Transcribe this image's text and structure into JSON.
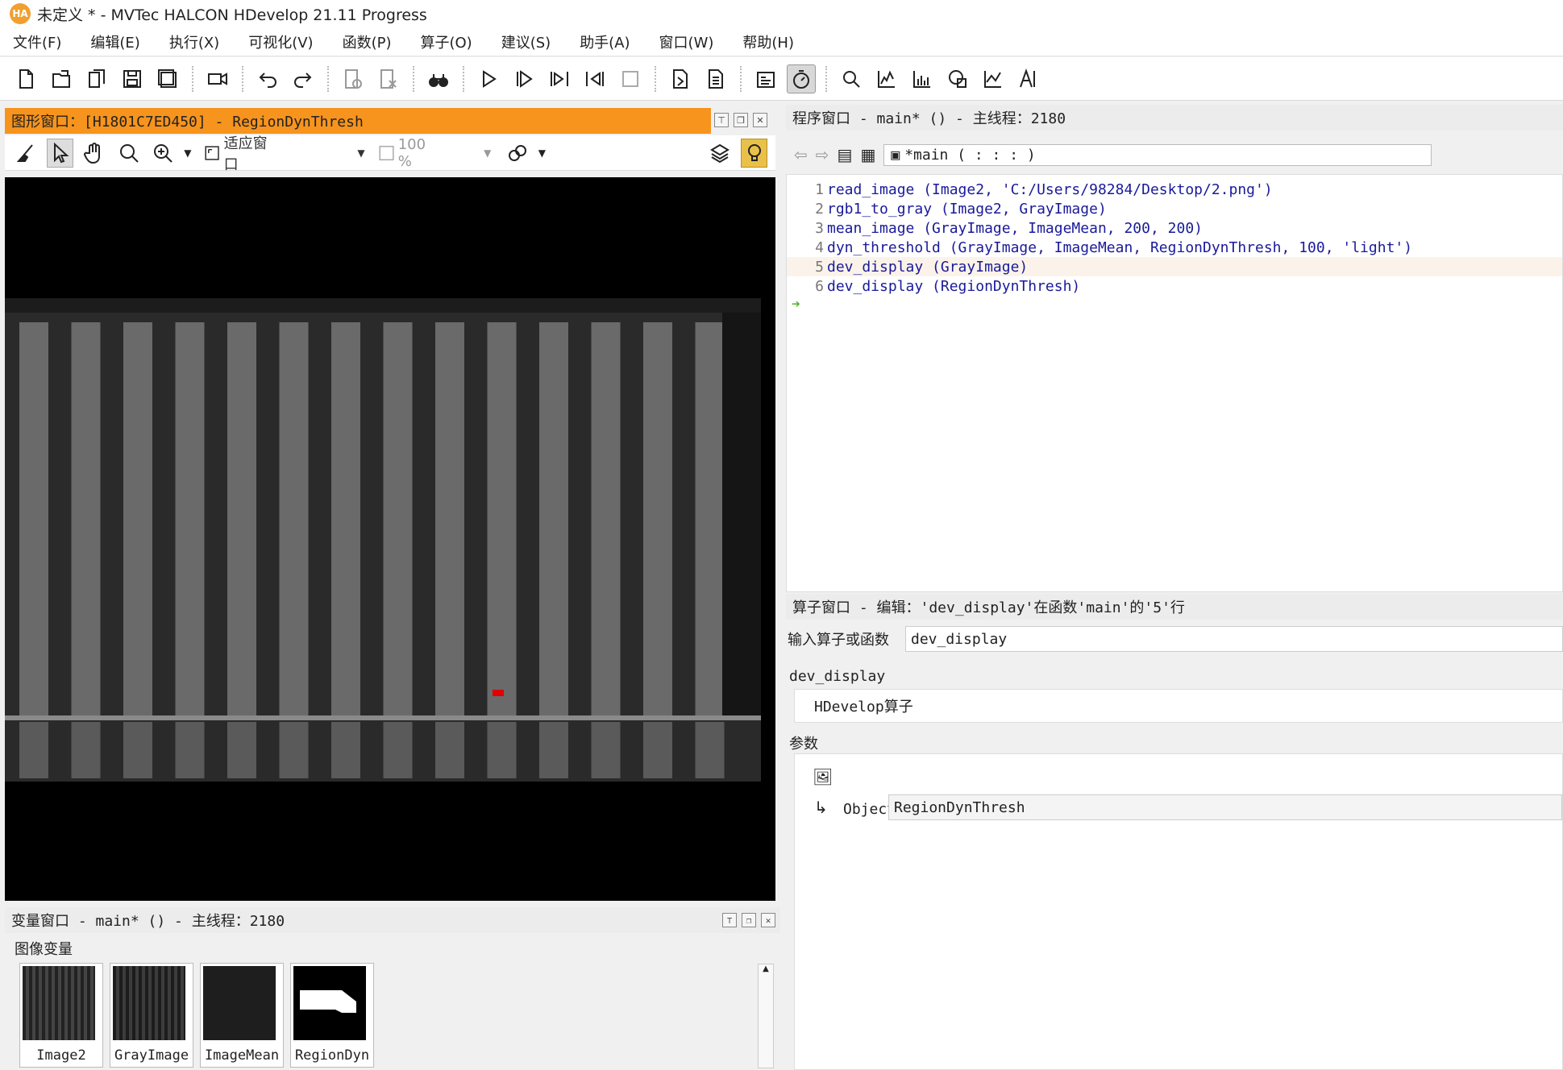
{
  "titlebar": {
    "logo": "HA",
    "title": "未定义 * - MVTec HALCON HDevelop 21.11 Progress"
  },
  "menu": [
    "文件(F)",
    "编辑(E)",
    "执行(X)",
    "可视化(V)",
    "函数(P)",
    "算子(O)",
    "建议(S)",
    "助手(A)",
    "窗口(W)",
    "帮助(H)"
  ],
  "graphics_window": {
    "title": "图形窗口：[H1801C7ED450] - RegionDynThresh",
    "fit_label": "适应窗口",
    "zoom_label": "100 %",
    "accent_color": "#f7941d"
  },
  "program_window": {
    "title": "程序窗口 - main* () - 主线程：2180",
    "procedure_label": "*main ( : : : )",
    "lines": [
      {
        "n": "1",
        "code": "read_image (Image2, 'C:/Users/98284/Desktop/2.png')"
      },
      {
        "n": "2",
        "code": "rgb1_to_gray (Image2, GrayImage)"
      },
      {
        "n": "3",
        "code": "mean_image (GrayImage, ImageMean, 200, 200)"
      },
      {
        "n": "4",
        "code": "dyn_threshold (GrayImage, ImageMean, RegionDynThresh, 100, 'light')"
      },
      {
        "n": "5",
        "code": "dev_display (GrayImage)"
      },
      {
        "n": "6",
        "code": "dev_display (RegionDynThresh)"
      }
    ]
  },
  "operator_window": {
    "title": "算子窗口 - 编辑：'dev_display'在函数'main'的'5'行",
    "input_label": "输入算子或函数",
    "input_value": "dev_display",
    "operator_name": "dev_display",
    "operator_type": "HDevelop算子",
    "params_label": "参数",
    "param_name": "Object",
    "param_value": "RegionDynThresh"
  },
  "variable_window": {
    "title": "变量窗口 - main* () - 主线程：2180",
    "section_label": "图像变量",
    "variables": [
      "Image2",
      "GrayImage",
      "ImageMean",
      "RegionDyn"
    ]
  }
}
